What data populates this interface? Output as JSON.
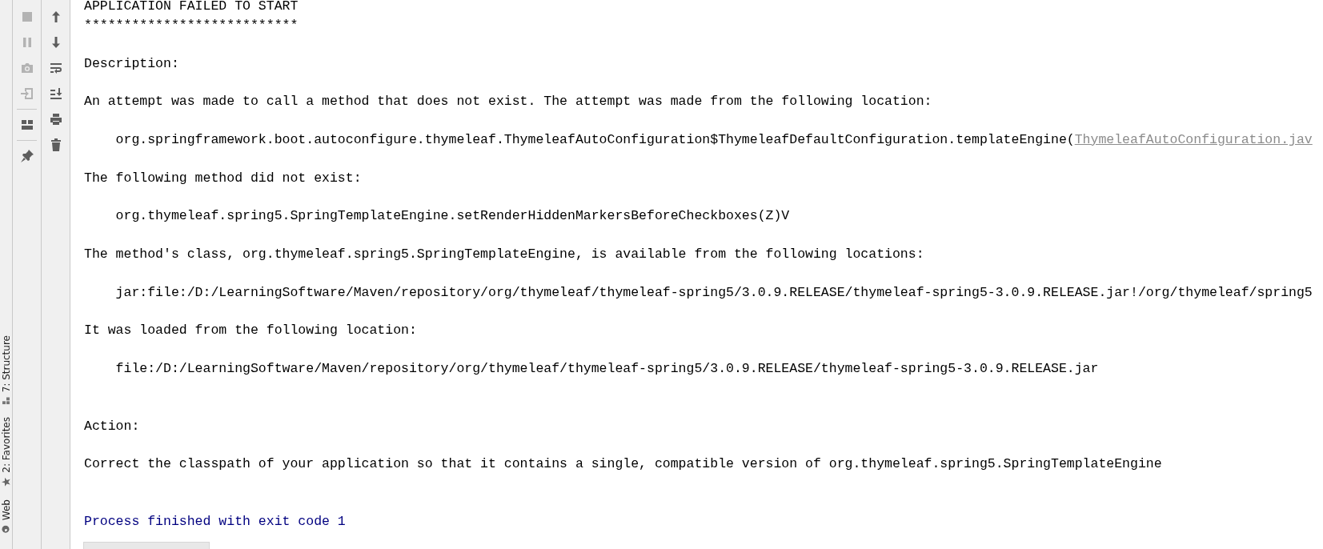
{
  "tool_window_tabs": [
    {
      "label": "7: Structure"
    },
    {
      "label": "2: Favorites"
    },
    {
      "label": "Web"
    }
  ],
  "run_toolbar": [
    {
      "disabled": true
    },
    {
      "disabled": true
    },
    {
      "disabled": true
    },
    {
      "disabled": true
    },
    {
      "disabled": false
    },
    {
      "disabled": false
    }
  ],
  "console_toolbar": [
    {
      "disabled": false
    },
    {
      "disabled": false
    },
    {
      "disabled": false
    },
    {
      "disabled": false
    },
    {
      "disabled": false
    },
    {
      "disabled": false
    }
  ],
  "console": {
    "lines": [
      {
        "kind": "text",
        "text": "APPLICATION FAILED TO START"
      },
      {
        "kind": "text",
        "text": "***************************"
      },
      {
        "kind": "blank"
      },
      {
        "kind": "text",
        "text": "Description:"
      },
      {
        "kind": "blank"
      },
      {
        "kind": "text",
        "text": "An attempt was made to call a method that does not exist. The attempt was made from the following location:"
      },
      {
        "kind": "blank"
      },
      {
        "kind": "text",
        "text": "    org.springframework.boot.autoconfigure.thymeleaf.ThymeleafAutoConfiguration$ThymeleafDefaultConfiguration.templateEngine(",
        "link": "ThymeleafAutoConfiguration.jav"
      },
      {
        "kind": "blank"
      },
      {
        "kind": "text",
        "text": "The following method did not exist:"
      },
      {
        "kind": "blank"
      },
      {
        "kind": "text",
        "text": "    org.thymeleaf.spring5.SpringTemplateEngine.setRenderHiddenMarkersBeforeCheckboxes(Z)V"
      },
      {
        "kind": "blank"
      },
      {
        "kind": "text",
        "text": "The method's class, org.thymeleaf.spring5.SpringTemplateEngine, is available from the following locations:"
      },
      {
        "kind": "blank"
      },
      {
        "kind": "text",
        "text": "    jar:file:/D:/LearningSoftware/Maven/repository/org/thymeleaf/thymeleaf-spring5/3.0.9.RELEASE/thymeleaf-spring5-3.0.9.RELEASE.jar!/org/thymeleaf/spring5"
      },
      {
        "kind": "blank"
      },
      {
        "kind": "text",
        "text": "It was loaded from the following location:"
      },
      {
        "kind": "blank"
      },
      {
        "kind": "text",
        "text": "    file:/D:/LearningSoftware/Maven/repository/org/thymeleaf/thymeleaf-spring5/3.0.9.RELEASE/thymeleaf-spring5-3.0.9.RELEASE.jar"
      },
      {
        "kind": "blank"
      },
      {
        "kind": "blank"
      },
      {
        "kind": "text",
        "text": "Action:"
      },
      {
        "kind": "blank"
      },
      {
        "kind": "text",
        "text": "Correct the classpath of your application so that it contains a single, compatible version of org.thymeleaf.spring5.SpringTemplateEngine"
      },
      {
        "kind": "blank"
      },
      {
        "kind": "blank"
      },
      {
        "kind": "exit",
        "text": "Process finished with exit code 1"
      }
    ]
  }
}
